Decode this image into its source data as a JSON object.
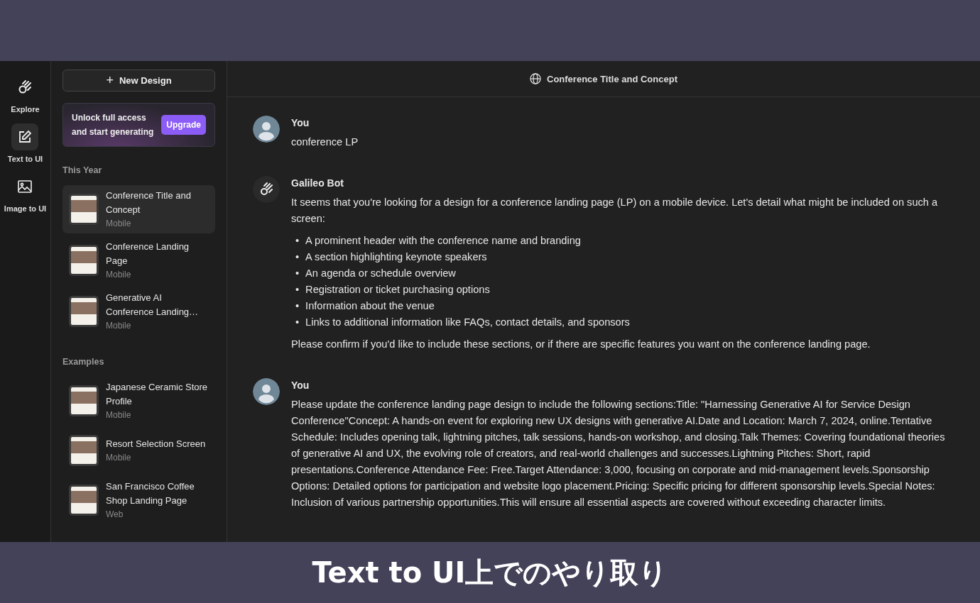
{
  "rail": {
    "items": [
      {
        "label": "Explore",
        "selected": false
      },
      {
        "label": "Text to UI",
        "selected": true
      },
      {
        "label": "Image to UI",
        "selected": false
      }
    ]
  },
  "sidebar": {
    "new_design": {
      "icon": "+",
      "label": "New Design"
    },
    "promo": {
      "text": "Unlock full access and start generating",
      "button": "Upgrade"
    },
    "sections": [
      {
        "heading": "This Year",
        "items": [
          {
            "title": "Conference Title and Concept",
            "subtitle": "Mobile",
            "selected": true
          },
          {
            "title": "Conference Landing Page",
            "subtitle": "Mobile",
            "selected": false
          },
          {
            "title": "Generative AI Conference Landing…",
            "subtitle": "Mobile",
            "selected": false
          }
        ]
      },
      {
        "heading": "Examples",
        "items": [
          {
            "title": "Japanese Ceramic Store Profile",
            "subtitle": "Mobile",
            "selected": false
          },
          {
            "title": "Resort Selection Screen",
            "subtitle": "Mobile",
            "selected": false
          },
          {
            "title": "San Francisco Coffee Shop Landing Page",
            "subtitle": "Web",
            "selected": false
          }
        ]
      }
    ]
  },
  "chat": {
    "title": "Conference Title and Concept",
    "messages": [
      {
        "kind": "user",
        "author": "You",
        "blocks": [
          {
            "kind": "p",
            "text": "conference LP"
          }
        ]
      },
      {
        "kind": "bot",
        "author": "Galileo Bot",
        "blocks": [
          {
            "kind": "p",
            "text": "It seems that you're looking for a design for a conference landing page (LP) on a mobile device. Let's detail what might be included on such a screen:"
          },
          {
            "kind": "list",
            "marker": "•",
            "items": [
              "A prominent header with the conference name and branding",
              "A section highlighting keynote speakers",
              "An agenda or schedule overview",
              "Registration or ticket purchasing options",
              "Information about the venue",
              "Links to additional information like FAQs, contact details, and sponsors"
            ]
          },
          {
            "kind": "p",
            "text": "Please confirm if you'd like to include these sections, or if there are specific features you want on the conference landing page."
          }
        ]
      },
      {
        "kind": "user",
        "author": "You",
        "blocks": [
          {
            "kind": "p",
            "text": "Please update the conference landing page design to include the following sections:Title: \"Harnessing Generative AI for Service Design Conference\"Concept: A hands-on event for exploring new UX designs with generative AI.Date and Location: March 7, 2024, online.Tentative Schedule: Includes opening talk, lightning pitches, talk sessions, hands-on workshop, and closing.Talk Themes: Covering foundational theories of generative AI and UX, the evolving role of creators, and real-world challenges and successes.Lightning Pitches: Short, rapid presentations.Conference Attendance Fee: Free.Target Attendance: 3,000, focusing on corporate and mid-management levels.Sponsorship Options: Detailed options for participation and website logo placement.Pricing: Specific pricing for different sponsorship levels.Special Notes: Inclusion of various partnership opportunities.This will ensure all essential aspects are covered without exceeding character limits."
          }
        ]
      }
    ]
  },
  "caption": "Text to UI上でのやり取り"
}
